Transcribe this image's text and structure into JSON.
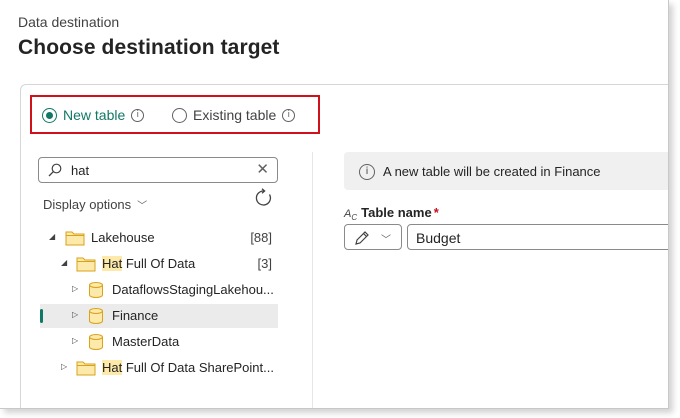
{
  "header": {
    "subtitle": "Data destination",
    "title": "Choose destination target"
  },
  "mode": {
    "options": [
      {
        "label": "New table",
        "selected": true
      },
      {
        "label": "Existing table",
        "selected": false
      }
    ],
    "accent_color": "#117865",
    "highlight_box_color": "#d0101a"
  },
  "search": {
    "value": "hat",
    "clear_icon": "close-icon"
  },
  "display_options": {
    "label": "Display options"
  },
  "tree": {
    "items": [
      {
        "prefix": "",
        "match": "",
        "suffix": "Lakehouse",
        "count": "[88]",
        "icon": "folder-icon",
        "expanded": true,
        "level": 0
      },
      {
        "prefix": "",
        "match": "Hat",
        "suffix": " Full Of Data",
        "count": "[3]",
        "icon": "folder-icon",
        "expanded": true,
        "level": 1
      },
      {
        "prefix": "",
        "match": "",
        "suffix": "DataflowsStagingLakehou...",
        "count": "",
        "icon": "lakehouse-icon",
        "expanded": false,
        "level": 2
      },
      {
        "prefix": "",
        "match": "",
        "suffix": "Finance",
        "count": "",
        "icon": "lakehouse-icon",
        "expanded": false,
        "level": 2,
        "selected": true
      },
      {
        "prefix": "",
        "match": "",
        "suffix": "MasterData",
        "count": "",
        "icon": "lakehouse-icon",
        "expanded": false,
        "level": 2
      },
      {
        "prefix": "",
        "match": "Hat",
        "suffix": " Full Of Data SharePoint...",
        "count": "",
        "icon": "folder-icon",
        "expanded": false,
        "level": 1
      }
    ],
    "match_highlight_color": "#fde9a9"
  },
  "info": {
    "message": "A new table will be created in Finance"
  },
  "table_name": {
    "label": "Table name",
    "required_mark": "*",
    "value": "Budget"
  }
}
